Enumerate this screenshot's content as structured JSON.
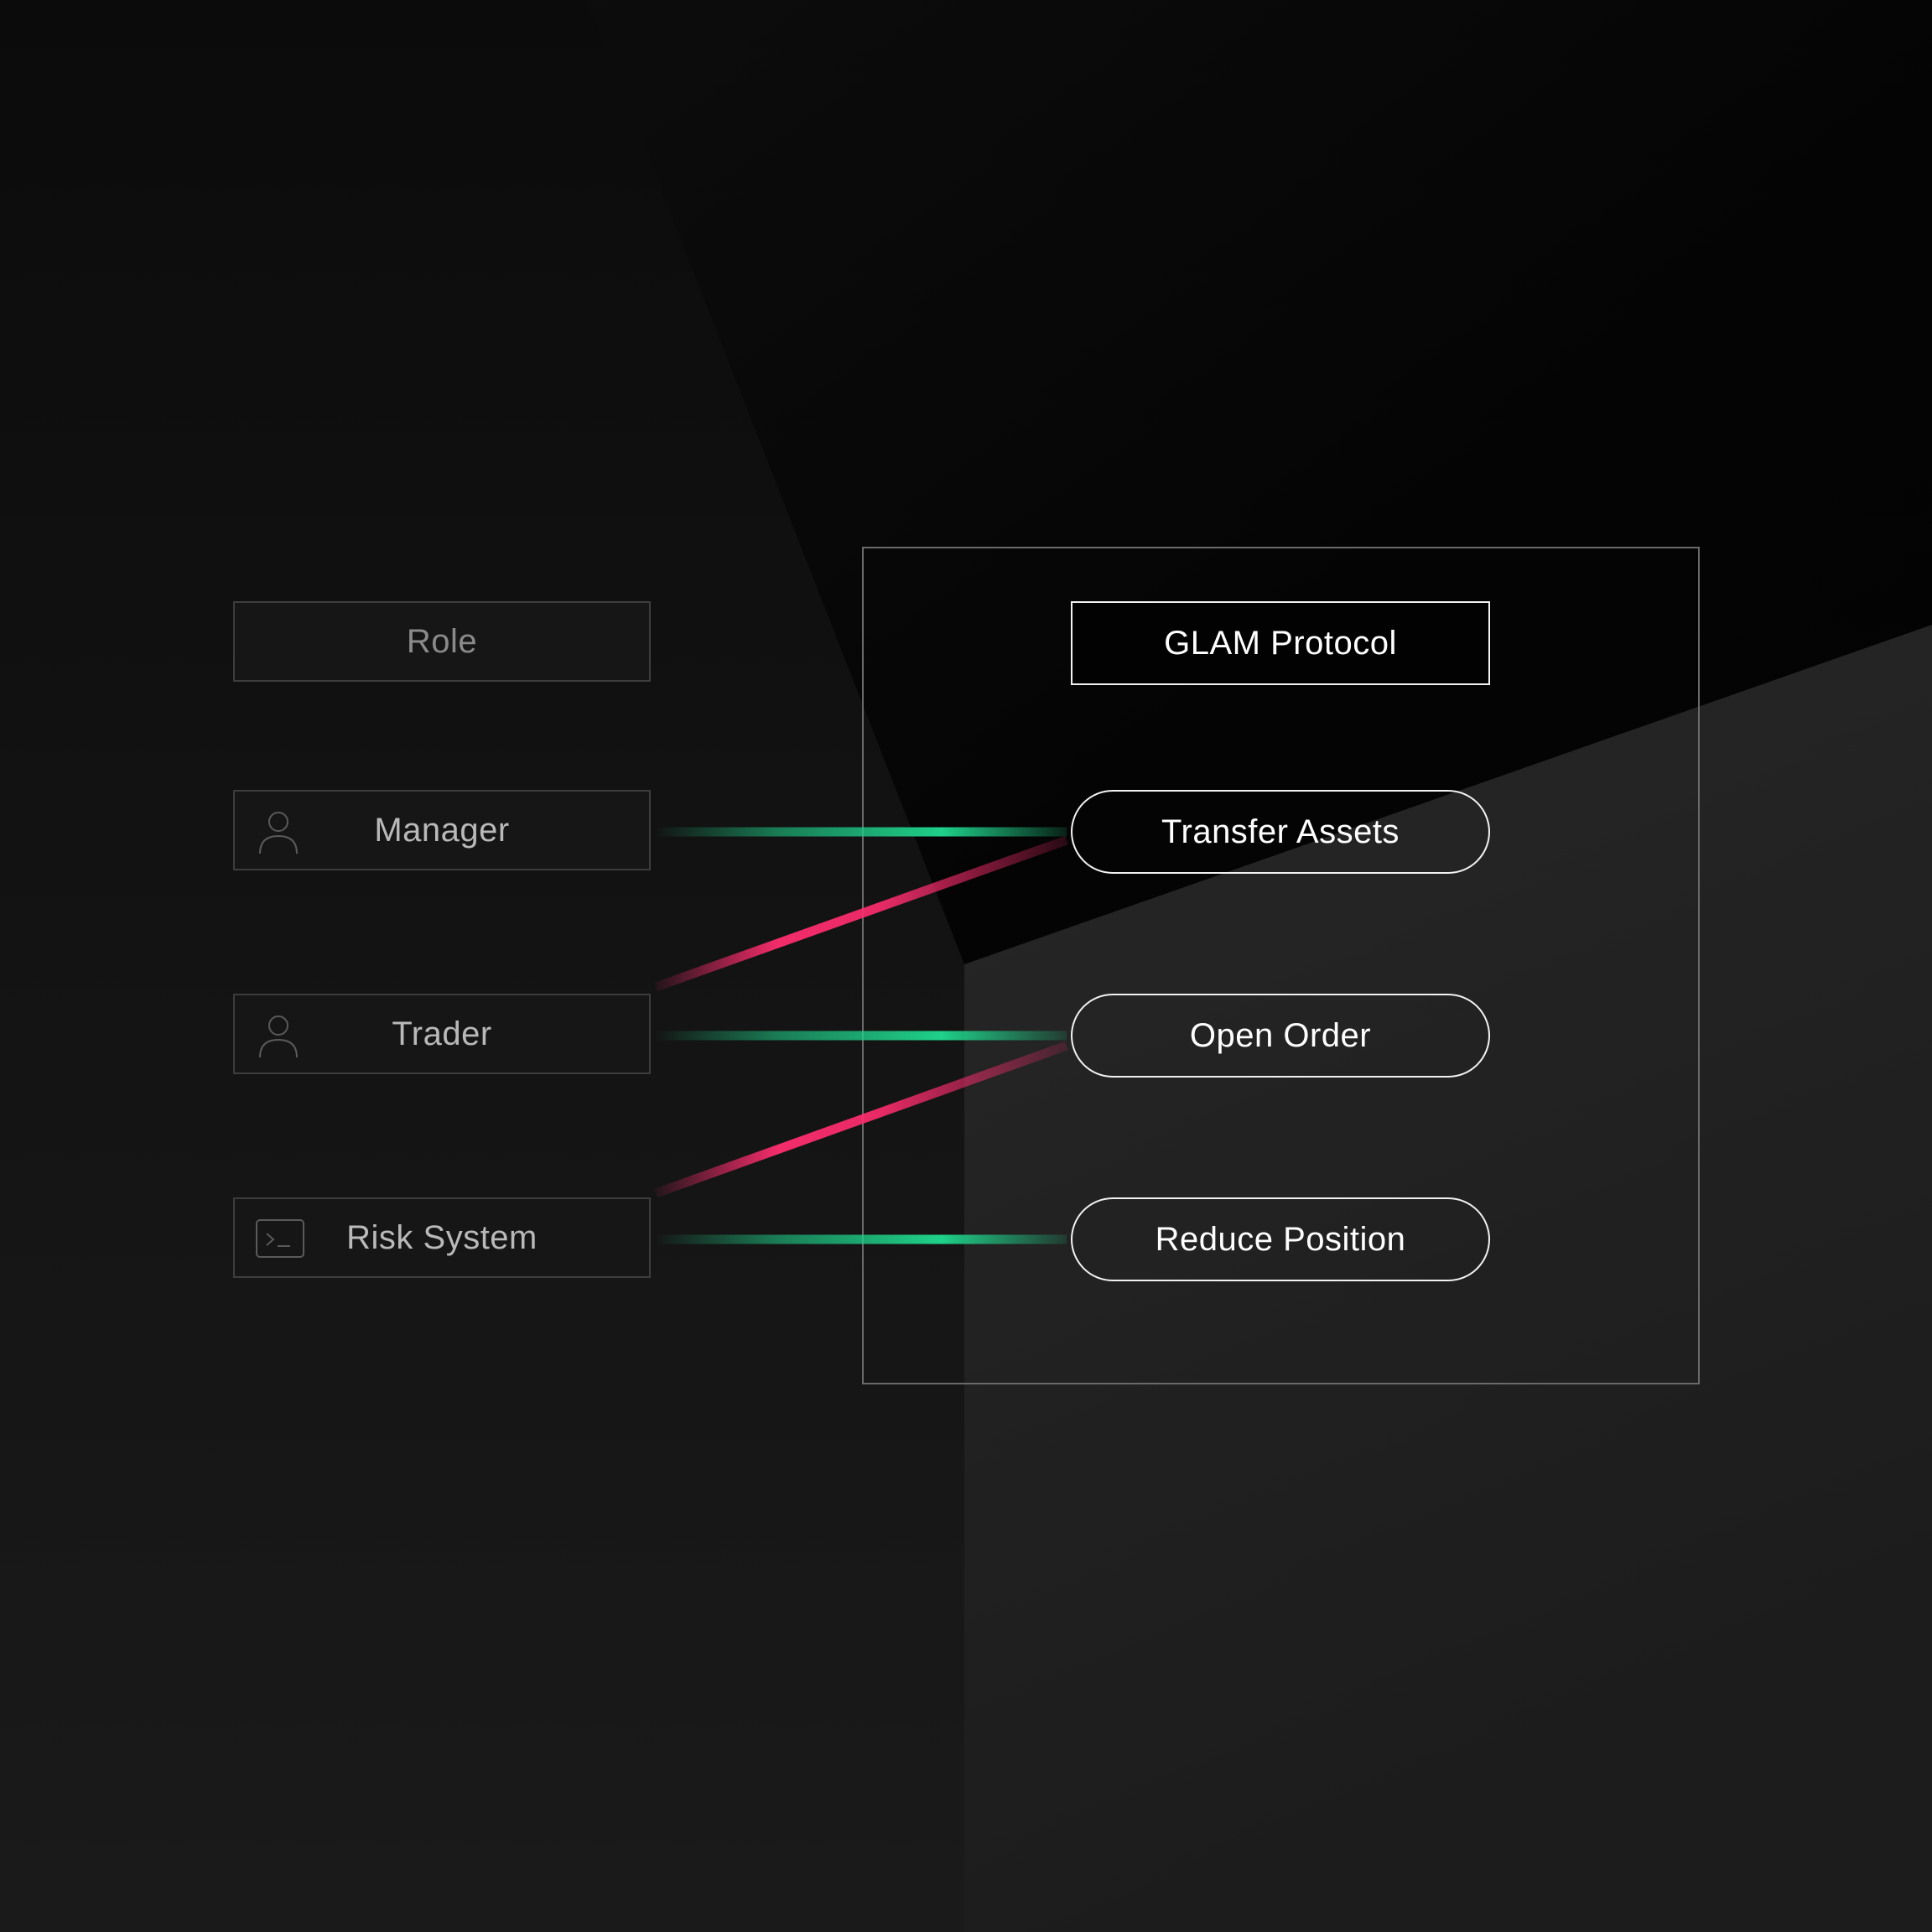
{
  "role_column": {
    "header": "Role",
    "roles": [
      {
        "label": "Manager",
        "icon": "user-icon"
      },
      {
        "label": "Trader",
        "icon": "user-icon"
      },
      {
        "label": "Risk System",
        "icon": "terminal-icon"
      }
    ]
  },
  "protocol": {
    "title": "GLAM Protocol",
    "actions": [
      {
        "label": "Transfer Assets"
      },
      {
        "label": "Open Order"
      },
      {
        "label": "Reduce Position"
      }
    ]
  },
  "connections": [
    {
      "from": "Manager",
      "to": "Transfer Assets",
      "type": "allowed"
    },
    {
      "from": "Trader",
      "to": "Transfer Assets",
      "type": "denied"
    },
    {
      "from": "Trader",
      "to": "Open Order",
      "type": "allowed"
    },
    {
      "from": "Risk System",
      "to": "Open Order",
      "type": "denied"
    },
    {
      "from": "Risk System",
      "to": "Reduce Position",
      "type": "allowed"
    }
  ],
  "colors": {
    "allowed": "#1fd18a",
    "denied": "#ff2d6f",
    "frame": "#6a6a6a",
    "pill_border": "#f2f2f2"
  }
}
